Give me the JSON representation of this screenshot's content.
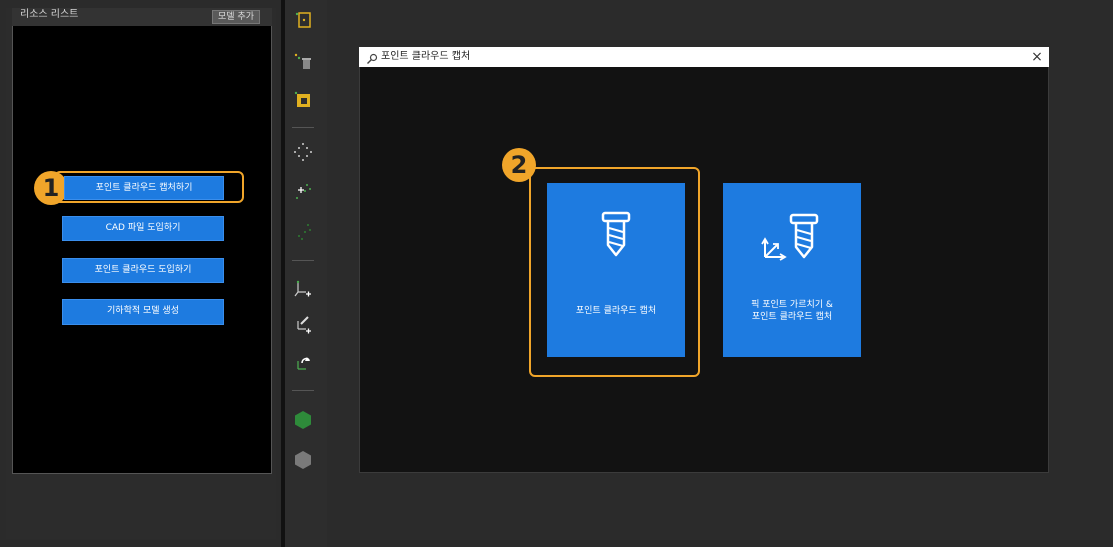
{
  "resource_panel": {
    "title": "리소스 리스트",
    "add_model_label": "모델 추가"
  },
  "left_actions": [
    {
      "label": "포인트 클라우드 캡처하기"
    },
    {
      "label": "CAD 파일 도입하기"
    },
    {
      "label": "포인트 클라우드 도입하기"
    },
    {
      "label": "기하학적 모델 생성"
    }
  ],
  "callouts": {
    "step1": "1",
    "step2": "2"
  },
  "dialog": {
    "title": "포인트 클라우드 캡처",
    "close_glyph": "×",
    "cards": [
      {
        "label": "포인트 클라우드 캡처",
        "icon": "screw-icon"
      },
      {
        "label_lines": [
          "픽 포인트 가르치기 &",
          "포인트 클라우드 캡처"
        ],
        "icon": "axes-screw-icon"
      }
    ]
  },
  "toolbar": {
    "icons": [
      "add-model-icon",
      "delete-model-icon",
      "model-settings-icon",
      "point-cloud-icon",
      "add-points-icon",
      "remove-points-icon",
      "add-pick-point-icon",
      "edit-pick-point-icon",
      "rotate-pick-point-icon",
      "green-cube-icon",
      "gray-cube-icon"
    ]
  },
  "colors": {
    "accent_blue": "#1e7be0",
    "callout_orange": "#f0a52a",
    "panel_bg": "#000000"
  }
}
